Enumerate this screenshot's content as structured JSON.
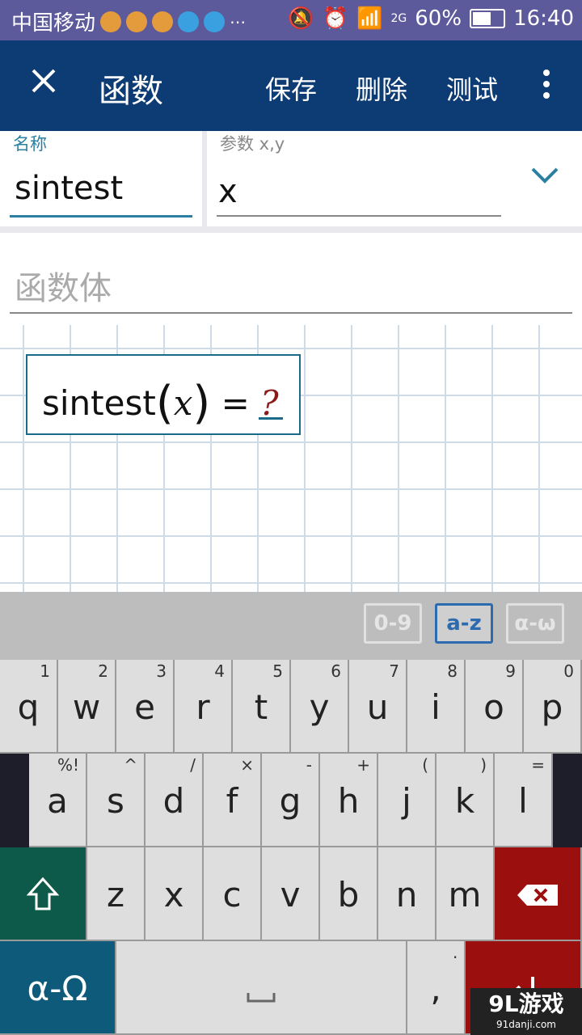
{
  "status_bar": {
    "carrier": "中国移动",
    "network": "2G",
    "battery": "60%",
    "time": "16:40"
  },
  "app_bar": {
    "title": "函数",
    "actions": {
      "save": "保存",
      "delete": "删除",
      "test": "测试"
    }
  },
  "form": {
    "name": {
      "label": "名称",
      "value": "sintest"
    },
    "params": {
      "label": "参数 x,y",
      "value": "x"
    },
    "body": {
      "placeholder": "函数体"
    }
  },
  "expression": {
    "name": "sintest",
    "var": "x",
    "equals": "=",
    "placeholder": "?"
  },
  "keyboard": {
    "modes": [
      "0-9",
      "a-z",
      "α-ω"
    ],
    "active_mode": "a-z",
    "row1": [
      {
        "key": "q",
        "hint": "1"
      },
      {
        "key": "w",
        "hint": "2"
      },
      {
        "key": "e",
        "hint": "3"
      },
      {
        "key": "r",
        "hint": "4"
      },
      {
        "key": "t",
        "hint": "5"
      },
      {
        "key": "y",
        "hint": "6"
      },
      {
        "key": "u",
        "hint": "7"
      },
      {
        "key": "i",
        "hint": "8"
      },
      {
        "key": "o",
        "hint": "9"
      },
      {
        "key": "p",
        "hint": "0"
      }
    ],
    "row2": [
      {
        "key": "a",
        "hint": "%!"
      },
      {
        "key": "s",
        "hint": "^"
      },
      {
        "key": "d",
        "hint": "/"
      },
      {
        "key": "f",
        "hint": "×"
      },
      {
        "key": "g",
        "hint": "-"
      },
      {
        "key": "h",
        "hint": "+"
      },
      {
        "key": "j",
        "hint": "("
      },
      {
        "key": "k",
        "hint": ")"
      },
      {
        "key": "l",
        "hint": "="
      }
    ],
    "row3": [
      "z",
      "x",
      "c",
      "v",
      "b",
      "n",
      "m"
    ],
    "alpha_key": "α-Ω",
    "comma_key": ",",
    "comma_hint": "."
  },
  "watermark": {
    "brand": "9L游戏",
    "url": "91danji.com"
  }
}
